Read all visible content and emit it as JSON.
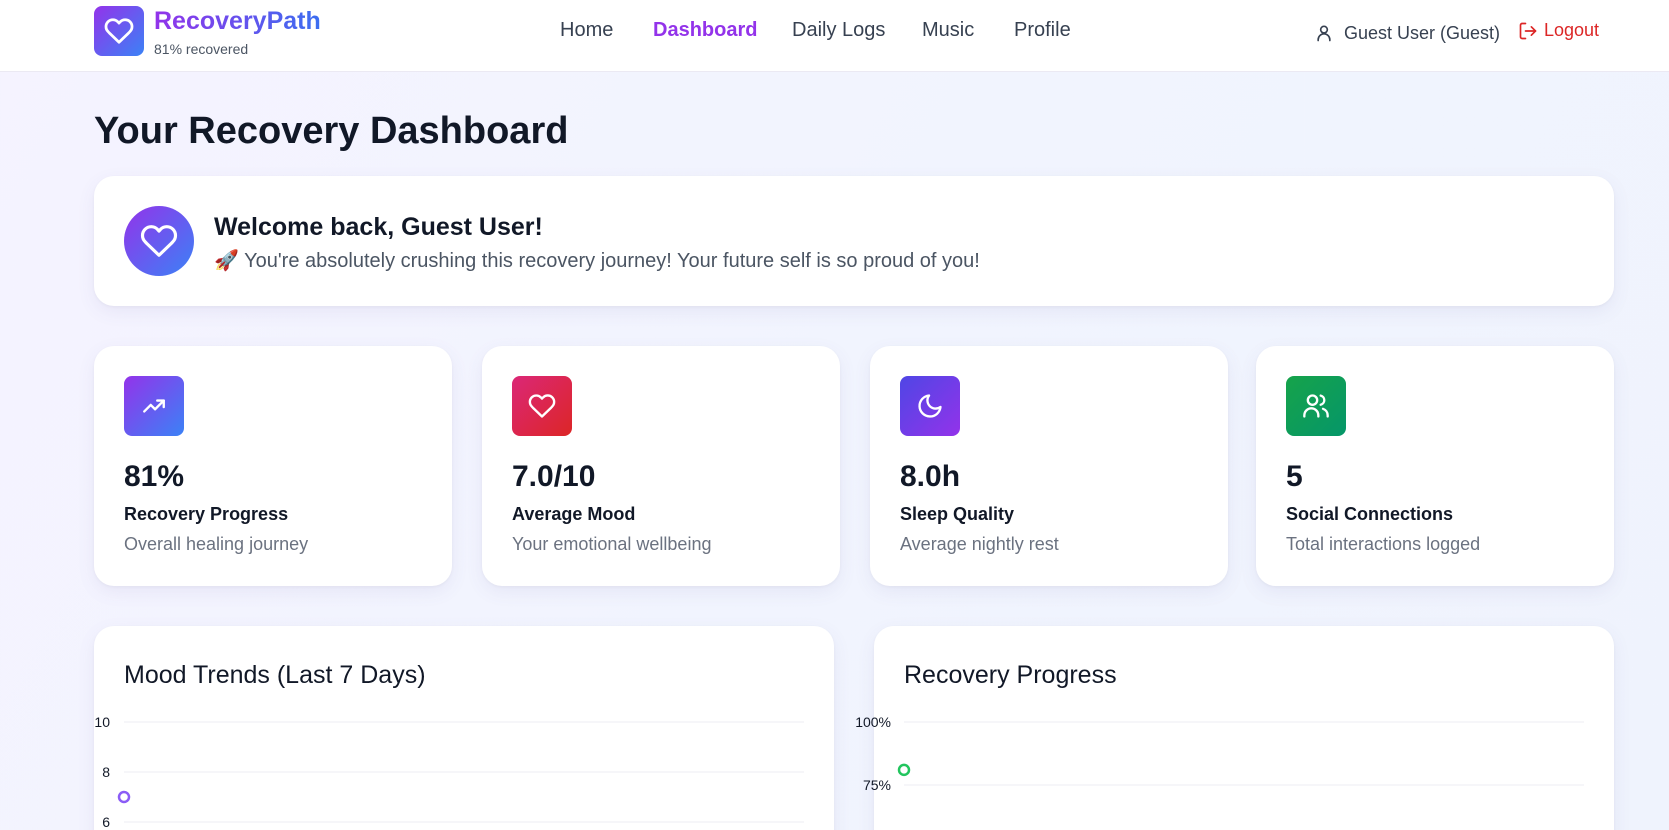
{
  "header": {
    "brand": "RecoveryPath",
    "subtitle": "81% recovered",
    "nav": [
      {
        "label": "Home",
        "active": false
      },
      {
        "label": "Dashboard",
        "active": true
      },
      {
        "label": "Daily Logs",
        "active": false
      },
      {
        "label": "Music",
        "active": false
      },
      {
        "label": "Profile",
        "active": false
      }
    ],
    "user": "Guest User (Guest)",
    "logout": "Logout"
  },
  "page_title": "Your Recovery Dashboard",
  "welcome": {
    "title": "Welcome back, Guest User!",
    "message": "🚀 You're absolutely crushing this recovery journey! Your future self is so proud of you!"
  },
  "stats": [
    {
      "icon": "trending-up-icon",
      "value": "81%",
      "label": "Recovery Progress",
      "description": "Overall healing journey",
      "color": "#7c3aed"
    },
    {
      "icon": "heart-icon",
      "value": "7.0/10",
      "label": "Average Mood",
      "description": "Your emotional wellbeing",
      "color": "#e11d48"
    },
    {
      "icon": "moon-icon",
      "value": "8.0h",
      "label": "Sleep Quality",
      "description": "Average nightly rest",
      "color": "#4f46e5"
    },
    {
      "icon": "users-icon",
      "value": "5",
      "label": "Social Connections",
      "description": "Total interactions logged",
      "color": "#059669"
    }
  ],
  "chart_data": [
    {
      "type": "line",
      "title": "Mood Trends (Last 7 Days)",
      "yticks": [
        "10",
        "8",
        "6"
      ],
      "ylim": [
        6,
        10
      ],
      "series": [
        {
          "values": [
            7
          ]
        }
      ],
      "color": "#8b5cf6"
    },
    {
      "type": "line",
      "title": "Recovery Progress",
      "yticks": [
        "100%",
        "75%"
      ],
      "ylim": [
        75,
        100
      ],
      "series": [
        {
          "values": [
            81
          ]
        }
      ],
      "color": "#22c55e"
    }
  ]
}
